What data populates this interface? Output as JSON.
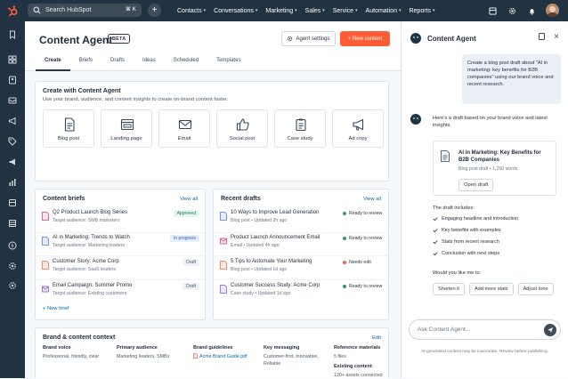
{
  "topbar": {
    "search_placeholder": "Search HubSpot",
    "shortcut": "⌘ K",
    "nav": [
      "Contacts",
      "Conversations",
      "Marketing",
      "Sales",
      "Service",
      "Automation",
      "Reports"
    ]
  },
  "header": {
    "title": "Content Agent",
    "badge": "BETA",
    "settings_label": "Agent settings",
    "new_label": "+ New content",
    "tabs": [
      "Create",
      "Briefs",
      "Drafts",
      "Ideas",
      "Scheduled",
      "Templates"
    ]
  },
  "create": {
    "title": "Create with Content Agent",
    "subtitle": "Use your brand, audience, and content insights to create on-brand content faster.",
    "tiles": [
      {
        "label": "Blog post",
        "icon": "document-icon"
      },
      {
        "label": "Landing page",
        "icon": "browser-icon"
      },
      {
        "label": "Email",
        "icon": "envelope-icon"
      },
      {
        "label": "Social post",
        "icon": "thumbs-up-icon"
      },
      {
        "label": "Case study",
        "icon": "clipboard-icon"
      },
      {
        "label": "Ad copy",
        "icon": "megaphone-icon"
      }
    ]
  },
  "briefs": {
    "title": "Content briefs",
    "view_all": "View all",
    "items": [
      {
        "title": "Q2 Product Launch Blog Series",
        "sub": "Target audience: SMB marketers",
        "badge": "Approved",
        "color": "#e03e7d"
      },
      {
        "title": "AI in Marketing: Trends to Watch",
        "sub": "Target audience: Marketing leaders",
        "badge": "In progress",
        "color": "#4b7bec"
      },
      {
        "title": "Customer Story: Acme Corp",
        "sub": "Target audience: SaaS leaders",
        "badge": "Draft",
        "color": "#f06a4a"
      },
      {
        "title": "Email Campaign: Summer Promo",
        "sub": "Target audience: Existing customers",
        "badge": "Draft",
        "color": "#7c5cd6"
      }
    ],
    "new_brief": "+ New brief"
  },
  "drafts": {
    "title": "Recent drafts",
    "view_all": "View all",
    "items": [
      {
        "title": "10 Ways to Improve Lead Generation",
        "sub": "Blog post • Updated 2h ago",
        "status": "Ready to review",
        "color": "#2e9d6a",
        "icon_color": "#4b7bec"
      },
      {
        "title": "Product Launch Announcement Email",
        "sub": "Email • Updated 4h ago",
        "status": "Ready to review",
        "color": "#2e9d6a",
        "icon_color": "#e03e7d"
      },
      {
        "title": "5 Tips to Automate Your Marketing",
        "sub": "Blog post • Updated 1d ago",
        "status": "Needs edit",
        "color": "#f06a4a",
        "icon_color": "#f06a4a"
      },
      {
        "title": "Customer Success Study: Acme Corp",
        "sub": "Case study • Updated 1d ago",
        "status": "Ready to review",
        "color": "#2e9d6a",
        "icon_color": "#7c5cd6"
      }
    ]
  },
  "brand": {
    "title": "Brand & content context",
    "edit": "Edit",
    "columns": [
      {
        "heading": "Brand voice",
        "value": "Professional, friendly, clear"
      },
      {
        "heading": "Primary audience",
        "value": "Marketing leaders, SMBs"
      },
      {
        "heading": "Brand guidelines",
        "value": "Acme Brand Guide.pdf"
      },
      {
        "heading": "Key messaging",
        "value": "Customer-first, Innovative, Reliable"
      },
      {
        "heading": "Reference materials",
        "value": "5 files"
      }
    ],
    "existing_heading": "Existing content",
    "existing_value": "120+ assets connected"
  },
  "panel": {
    "title": "Content Agent",
    "user_message": "Create a blog post draft about \"AI in marketing: key benefits for B2B companies\" using our brand voice and recent research.",
    "agent_message": "Here's a draft based on your brand voice and latest insights.",
    "draft_title": "AI in Marketing: Key Benefits for B2B Companies",
    "draft_meta": "Blog post draft • 1,250 words",
    "open_draft": "Open draft",
    "includes_label": "The draft includes:",
    "includes": [
      "Engaging headline and introduction",
      "Key benefits with examples",
      "Stats from recent research",
      "Conclusion with next steps"
    ],
    "ask": "Would you like me to:",
    "chips": [
      "Shorten it",
      "Add more stats",
      "Adjust tone"
    ],
    "input_placeholder": "Ask Content Agent...",
    "disclaimer": "AI-generated content may be inaccurate. Review before publishing."
  }
}
